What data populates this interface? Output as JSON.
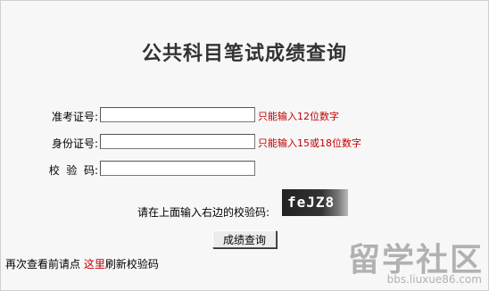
{
  "page": {
    "title": "公共科目笔试成绩查询"
  },
  "form": {
    "exam_no": {
      "label": "准考证号:",
      "value": "",
      "hint": "只能输入12位数字"
    },
    "id_no": {
      "label": "身份证号:",
      "value": "",
      "hint": "只能输入15或18位数字"
    },
    "code": {
      "label": "校  验  码:",
      "value": ""
    },
    "captcha_prompt": "请在上面输入右边的校验码:",
    "captcha_text": "feJZ8",
    "submit_label": "成绩查询"
  },
  "refresh": {
    "prefix": "再次查看前请点",
    "link": "这里",
    "suffix": "刷新校验码"
  },
  "watermark": {
    "text": "留学社区",
    "url": "bbs.liuxue86.com"
  }
}
